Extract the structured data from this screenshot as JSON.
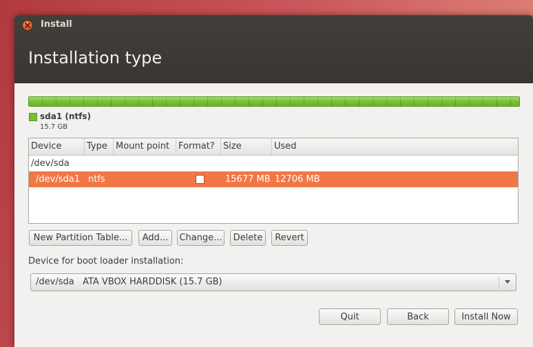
{
  "window": {
    "title": "Install",
    "page_title": "Installation type"
  },
  "partition_bar": {
    "color": "#77c12e",
    "legend_name": "sda1 (ntfs)",
    "legend_size": "15.7 GB"
  },
  "table": {
    "columns": [
      "Device",
      "Type",
      "Mount point",
      "Format?",
      "Size",
      "Used"
    ],
    "rows": [
      {
        "device": "/dev/sda"
      },
      {
        "device": "/dev/sda1",
        "type": "ntfs",
        "mount": "",
        "format": false,
        "size": "15677 MB",
        "used": "12706 MB",
        "selected": true
      }
    ],
    "selection_color": "#f07746"
  },
  "buttons": {
    "new_table": "New Partition Table...",
    "add": "Add...",
    "change": "Change...",
    "delete": "Delete",
    "revert": "Revert"
  },
  "boot_loader": {
    "label": "Device for boot loader installation:",
    "selected": "/dev/sda   ATA VBOX HARDDISK (15.7 GB)"
  },
  "footer": {
    "quit": "Quit",
    "back": "Back",
    "install_now": "Install Now"
  }
}
